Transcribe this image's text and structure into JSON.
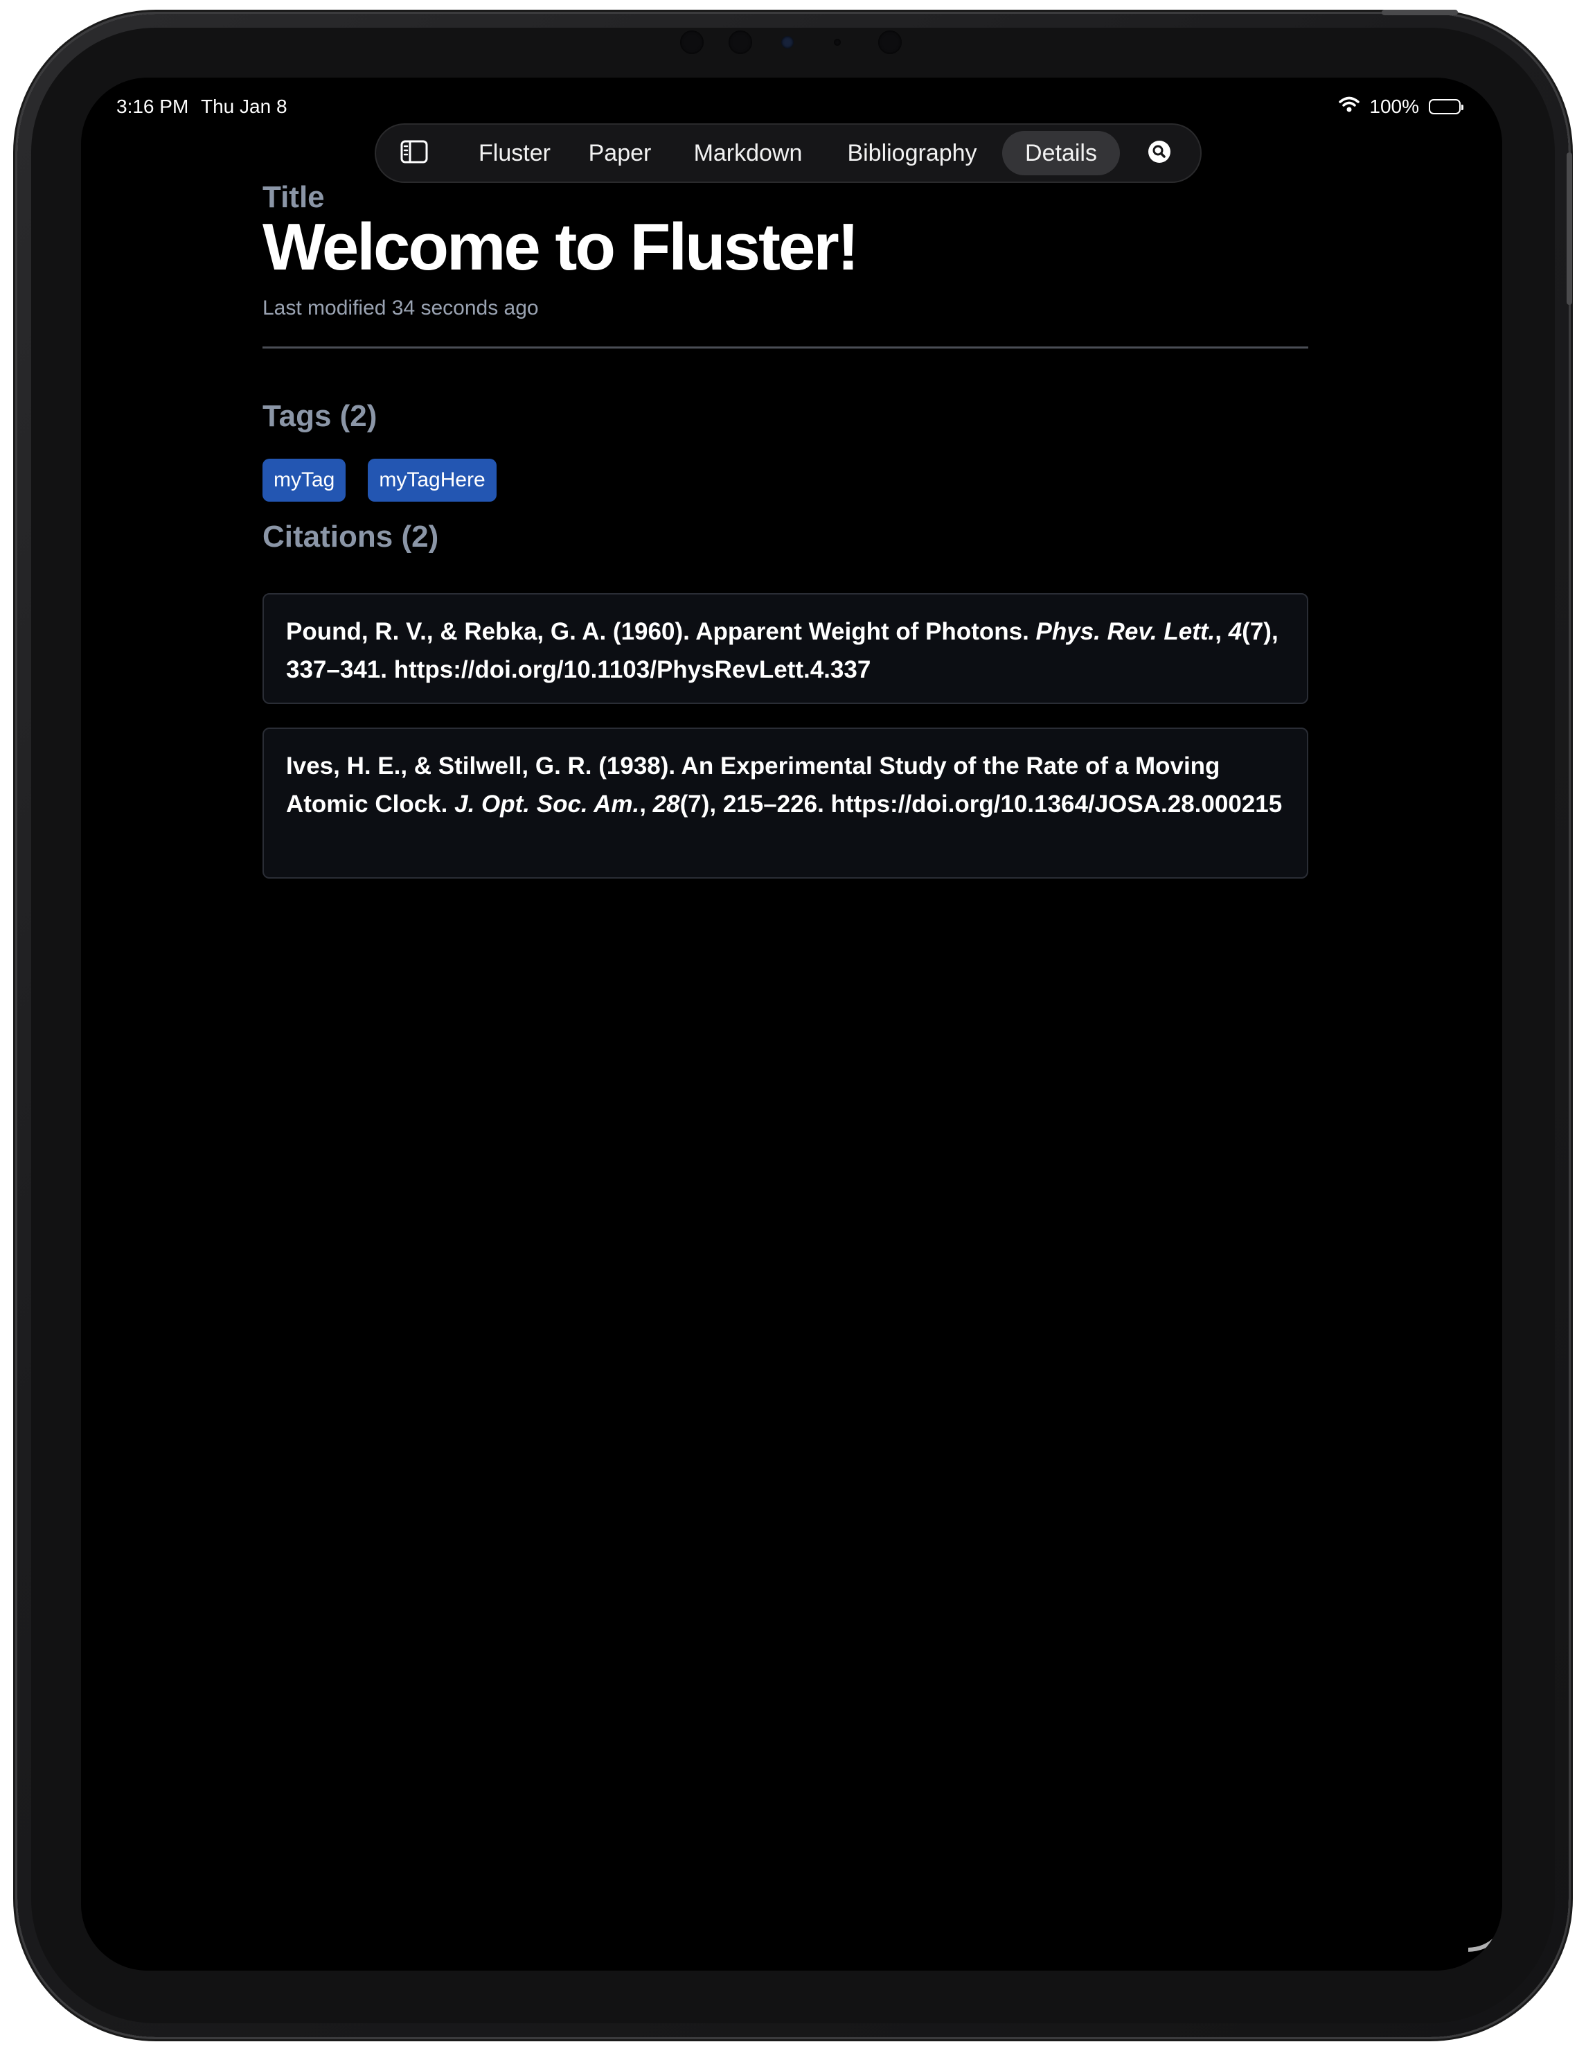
{
  "status_bar": {
    "time": "3:16 PM",
    "date": "Thu Jan 8",
    "battery": "100%",
    "battery_level": 1.0
  },
  "toolbar": {
    "sidebar_icon": "sidebar-toggle-icon",
    "tabs": [
      {
        "label": "Fluster"
      },
      {
        "label": "Paper"
      },
      {
        "label": "Markdown"
      },
      {
        "label": "Bibliography"
      },
      {
        "label": "Details",
        "active": true
      }
    ],
    "search_icon": "search-icon"
  },
  "details": {
    "title_label": "Title",
    "title": "Welcome to Fluster!",
    "last_modified": "Last modified 34 seconds ago",
    "tags_heading": "Tags (2)",
    "tags": [
      "myTag",
      "myTagHere"
    ],
    "citations_heading": "Citations (2)",
    "citations": [
      {
        "part1": "Pound, R. V., & Rebka, G. A. (1960). Apparent Weight of Photons. ",
        "journal": "Phys. Rev. Lett.",
        "part2": ", ",
        "volume": "4",
        "part3": "(7), 337–341. https://doi.org/10.1103/PhysRevLett.4.337"
      },
      {
        "part1": "Ives, H. E., & Stilwell, G. R. (1938). An Experimental Study of the Rate of a Moving Atomic Clock. ",
        "journal": "J. Opt. Soc. Am.",
        "part2": ", ",
        "volume": "28",
        "part3": "(7), 215–226. https://doi.org/10.1364/JOSA.28.000215"
      }
    ]
  },
  "colors": {
    "background": "#000000",
    "tag": "#2356b2",
    "label": "#8b96a7",
    "card": "#0c0e13"
  }
}
